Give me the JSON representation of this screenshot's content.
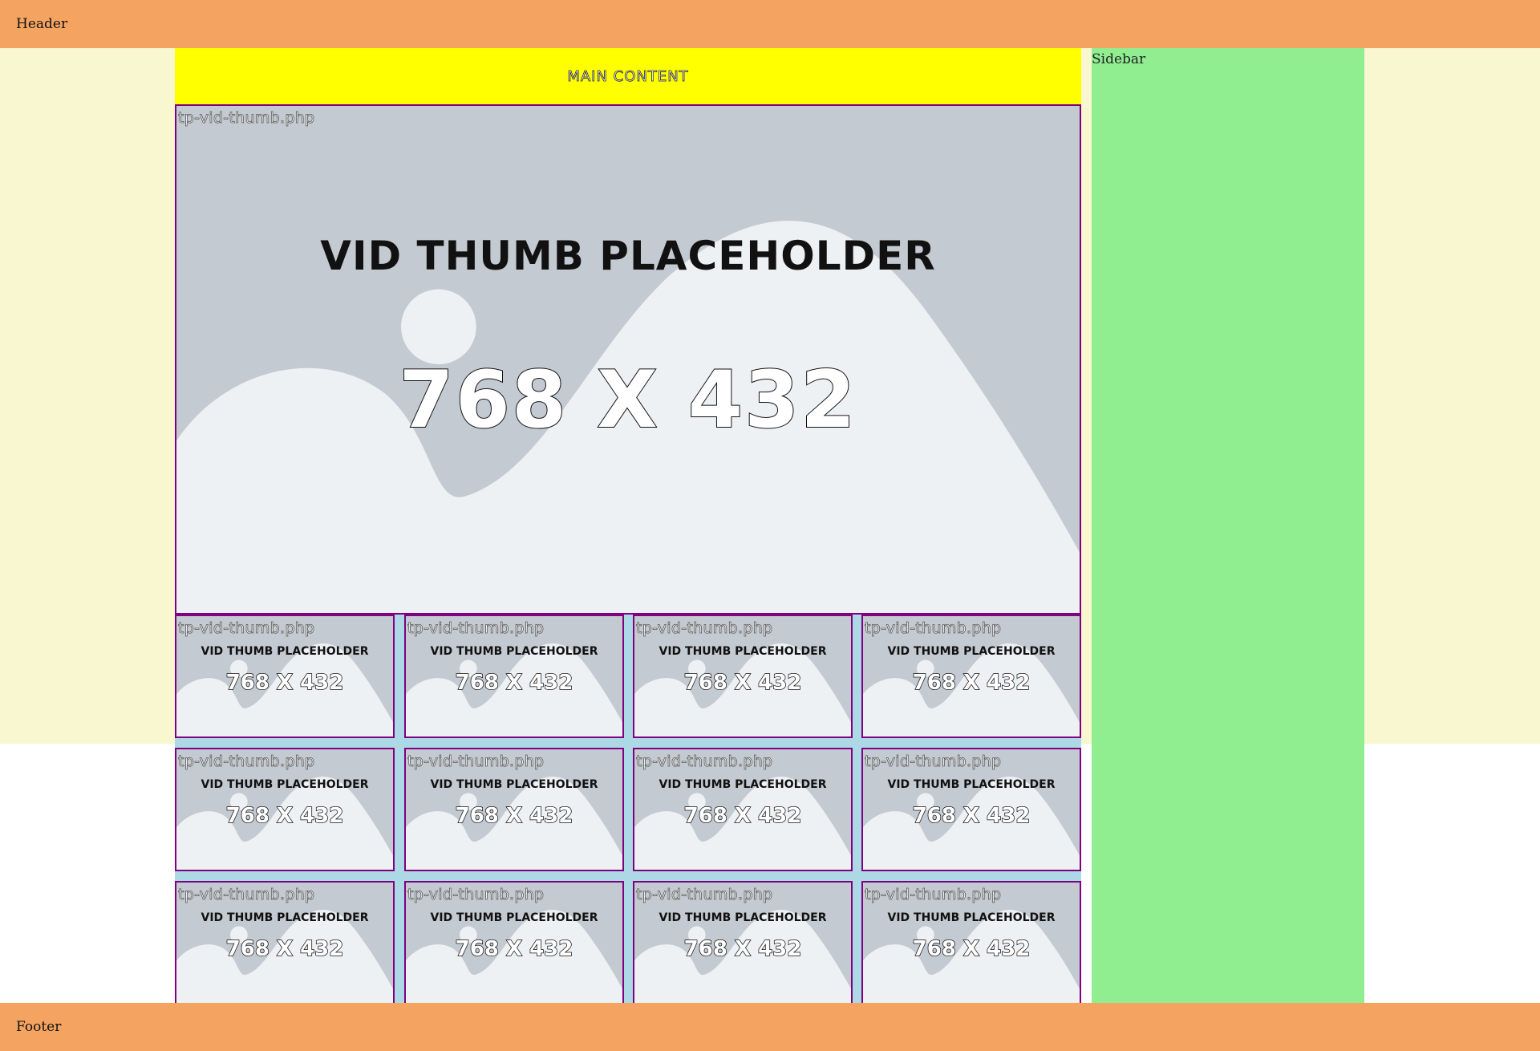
{
  "header": {
    "label": "Header"
  },
  "footer": {
    "label": "Footer"
  },
  "main": {
    "title": "MAIN CONTENT"
  },
  "sidebar": {
    "label": "Sidebar"
  },
  "featured": {
    "file": "tp-vid-thumb.php",
    "title": "VID THUMB PLACEHOLDER",
    "size": "768 X 432"
  },
  "grid": [
    {
      "file": "tp-vid-thumb.php",
      "title": "VID THUMB PLACEHOLDER",
      "size": "768 X 432"
    },
    {
      "file": "tp-vid-thumb.php",
      "title": "VID THUMB PLACEHOLDER",
      "size": "768 X 432"
    },
    {
      "file": "tp-vid-thumb.php",
      "title": "VID THUMB PLACEHOLDER",
      "size": "768 X 432"
    },
    {
      "file": "tp-vid-thumb.php",
      "title": "VID THUMB PLACEHOLDER",
      "size": "768 X 432"
    },
    {
      "file": "tp-vid-thumb.php",
      "title": "VID THUMB PLACEHOLDER",
      "size": "768 X 432"
    },
    {
      "file": "tp-vid-thumb.php",
      "title": "VID THUMB PLACEHOLDER",
      "size": "768 X 432"
    },
    {
      "file": "tp-vid-thumb.php",
      "title": "VID THUMB PLACEHOLDER",
      "size": "768 X 432"
    },
    {
      "file": "tp-vid-thumb.php",
      "title": "VID THUMB PLACEHOLDER",
      "size": "768 X 432"
    },
    {
      "file": "tp-vid-thumb.php",
      "title": "VID THUMB PLACEHOLDER",
      "size": "768 X 432"
    },
    {
      "file": "tp-vid-thumb.php",
      "title": "VID THUMB PLACEHOLDER",
      "size": "768 X 432"
    },
    {
      "file": "tp-vid-thumb.php",
      "title": "VID THUMB PLACEHOLDER",
      "size": "768 X 432"
    },
    {
      "file": "tp-vid-thumb.php",
      "title": "VID THUMB PLACEHOLDER",
      "size": "768 X 432"
    }
  ],
  "colors": {
    "header": "#f4a460",
    "main_title_bg": "#ffff00",
    "sidebar": "#90ee90",
    "page_bg": "#f8f7d0",
    "grid_bg": "#add8e6",
    "thumb_border": "#800080"
  }
}
